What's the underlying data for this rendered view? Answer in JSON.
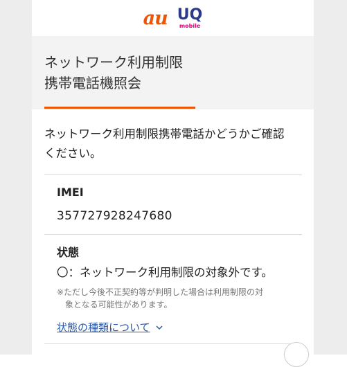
{
  "header": {
    "logo_au": "au",
    "logo_uq": "UQ",
    "logo_uq_sub": "mobile"
  },
  "title": {
    "line1": "ネットワーク利用制限",
    "line2": "携帯電話機照会"
  },
  "intro": {
    "line1": "ネットワーク利用制限携帯電話かどうかご確認",
    "line2": "ください。"
  },
  "imei": {
    "label": "IMEI",
    "value": "357727928247680"
  },
  "status": {
    "label": "状態",
    "text": "〇：ネットワーク利用制限の対象外です。",
    "note_line1": "※ただし今後不正契約等が判明した場合は利用制限の対",
    "note_line2": "象となる可能性があります。"
  },
  "link": {
    "label": "状態の種類について"
  },
  "colors": {
    "accent": "#eb5505",
    "link": "#2a58a6",
    "uq_blue": "#2b3a8c",
    "uq_pink": "#e6007e"
  }
}
